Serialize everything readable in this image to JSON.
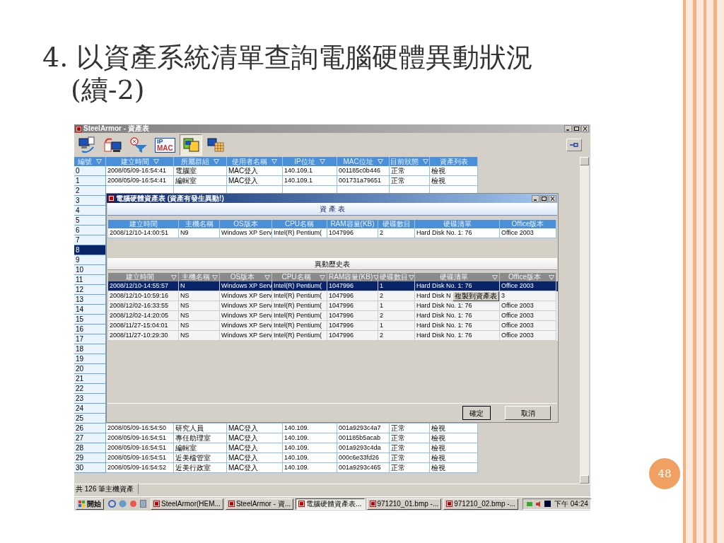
{
  "slide": {
    "title": "4. 以資產系統清單查詢電腦硬體異動狀況",
    "title_line_2": "(續-2)",
    "page_number": "48"
  },
  "app_window": {
    "title": "SteelArmor - 資產表",
    "toolbar": [
      {
        "kind": "computer-arrow",
        "selected": false
      },
      {
        "kind": "document-computer",
        "selected": false
      },
      {
        "kind": "filter-clear",
        "selected": false
      },
      {
        "kind": "ip-mac",
        "label_1": "IP",
        "label_2": "MAC",
        "selected": false
      },
      {
        "kind": "copy",
        "selected": true
      },
      {
        "kind": "computer-grid",
        "selected": false
      }
    ],
    "main_table": {
      "columns": [
        {
          "label": "編號",
          "filter": true
        },
        {
          "label": "建立時間",
          "filter": true
        },
        {
          "label": "所屬群組",
          "filter": true
        },
        {
          "label": "使用者名稱",
          "filter": true
        },
        {
          "label": "IP位址",
          "filter": true
        },
        {
          "label": "MAC位址",
          "filter": true
        },
        {
          "label": "目前狀態",
          "filter": true
        },
        {
          "label": "資產列表",
          "filter": false
        }
      ],
      "rows": [
        {
          "number": "0",
          "selected": false,
          "cells": [
            "2008/05/09-16:54:41",
            "電腦室",
            "MAC登入",
            "140.109.1",
            "001185c0b446",
            "正常",
            "檢視"
          ]
        },
        {
          "number": "1",
          "selected": false,
          "cells": [
            "2008/05/09-16:54:41",
            "編輯室",
            "MAC登入",
            "140.109.1",
            "001731a79651",
            "正常",
            "檢視"
          ]
        },
        {
          "number": "2",
          "selected": false
        },
        {
          "number": "3",
          "selected": false
        },
        {
          "number": "4",
          "selected": false
        },
        {
          "number": "5",
          "selected": false
        },
        {
          "number": "6",
          "selected": false
        },
        {
          "number": "7",
          "selected": false
        },
        {
          "number": "8",
          "selected": true
        },
        {
          "number": "9",
          "selected": false
        },
        {
          "number": "10",
          "selected": false
        },
        {
          "number": "11",
          "selected": false
        },
        {
          "number": "12",
          "selected": false
        },
        {
          "number": "13",
          "selected": false
        },
        {
          "number": "14",
          "selected": false
        },
        {
          "number": "15",
          "selected": false
        },
        {
          "number": "16",
          "selected": false
        },
        {
          "number": "17",
          "selected": false
        },
        {
          "number": "18",
          "selected": false
        },
        {
          "number": "19",
          "selected": false
        },
        {
          "number": "20",
          "selected": false
        },
        {
          "number": "21",
          "selected": false
        },
        {
          "number": "22",
          "selected": false
        },
        {
          "number": "23",
          "selected": false
        },
        {
          "number": "24",
          "selected": false
        },
        {
          "number": "25",
          "selected": false
        },
        {
          "number": "26",
          "selected": false,
          "cells": [
            "2008/05/09-16:54:50",
            "研究人員",
            "MAC登入",
            "140.109.",
            "001a9293c4a7",
            "正常",
            "檢視"
          ]
        },
        {
          "number": "27",
          "selected": false,
          "cells": [
            "2008/05/09-16:54:51",
            "專任助理室",
            "MAC登入",
            "140.109.",
            "001185b5acab",
            "正常",
            "檢視"
          ]
        },
        {
          "number": "28",
          "selected": false,
          "cells": [
            "2008/05/09-16:54:51",
            "編輯室",
            "MAC登入",
            "140.109.",
            "001a9293c4da",
            "正常",
            "檢視"
          ]
        },
        {
          "number": "29",
          "selected": false,
          "cells": [
            "2008/05/09-16:54:51",
            "近美檔管室",
            "MAC登入",
            "140.109.",
            "000c6e33fd26",
            "正常",
            "檢視"
          ]
        },
        {
          "number": "30",
          "selected": false,
          "cells": [
            "2008/05/09-16:54:52",
            "近美行政室",
            "MAC登入",
            "140.109.",
            "001a9293c465",
            "正常",
            "檢視"
          ]
        }
      ]
    },
    "status_bar": "共 126 筆主機資產"
  },
  "dialog": {
    "title": "電腦硬體資產表 (資產有發生異動!)",
    "asset_heading": "資 產 表",
    "asset_table": {
      "columns": [
        "建立時間",
        "主機名稱",
        "OS版本",
        "CPU名稱",
        "RAM容量(KB)",
        "硬碟數目",
        "硬碟清單",
        "Office版本"
      ],
      "rows": [
        [
          "2008/12/10-14:00:51",
          "N9",
          "Windows XP Serv",
          "Intel(R) Pentium(",
          "1047996",
          "2",
          "Hard Disk No. 1: 76",
          "Office 2003"
        ]
      ]
    },
    "history_heading": "異動歷史表",
    "history_table": {
      "columns": [
        "建立時間",
        "主機名稱",
        "OS版本",
        "CPU名稱",
        "RAM容量(KB)",
        "硬碟數目",
        "硬碟清單",
        "Office版本"
      ],
      "rows": [
        {
          "selected": true,
          "cells": [
            "2008/12/10-14:55:57",
            "N",
            "Windows XP Serv",
            "Intel(R) Pentium(",
            "1047996",
            "1",
            "Hard Disk No. 1: 76",
            "Office 2003"
          ]
        },
        {
          "selected": false,
          "cells": [
            "2008/12/10-10:59:16",
            "NS",
            "Windows XP Serv",
            "Intel(R) Pentium(",
            "1047996",
            "2",
            "Hard Disk N",
            "3"
          ]
        },
        {
          "selected": false,
          "cells": [
            "2008/12/02-16:33:55",
            "NS",
            "Windows XP Serv",
            "Intel(R) Pentium(",
            "1047996",
            "1",
            "Hard Disk No. 1: 76",
            "Office 2003"
          ]
        },
        {
          "selected": false,
          "cells": [
            "2008/12/02-14:20:05",
            "NS",
            "Windows XP Serv",
            "Intel(R) Pentium(",
            "1047996",
            "2",
            "Hard Disk No. 1: 76",
            "Office 2003"
          ]
        },
        {
          "selected": false,
          "cells": [
            "2008/11/27-15:04:01",
            "NS",
            "Windows XP Serv",
            "Intel(R) Pentium(",
            "1047996",
            "1",
            "Hard Disk No. 1: 76",
            "Office 2003"
          ]
        },
        {
          "selected": false,
          "cells": [
            "2008/11/27-10:29:30",
            "NS",
            "Windows XP Serv",
            "Intel(R) Pentium(",
            "1047996",
            "2",
            "Hard Disk No. 1: 76",
            "Office 2003"
          ]
        }
      ]
    },
    "context_menu": [
      "複製到資產表"
    ],
    "buttons": [
      "確定",
      "取消"
    ]
  },
  "taskbar": {
    "start": "開始",
    "tasks": [
      {
        "label": "SteelArmor(HEM...",
        "selected": false
      },
      {
        "label": "SteelArmor - 資...",
        "selected": false
      },
      {
        "label": "電腦硬體資產表...",
        "selected": true
      },
      {
        "label": "971210_01.bmp -...",
        "selected": false
      },
      {
        "label": "971210_02.bmp -...",
        "selected": false
      }
    ],
    "clock": "下午 04:24"
  }
}
